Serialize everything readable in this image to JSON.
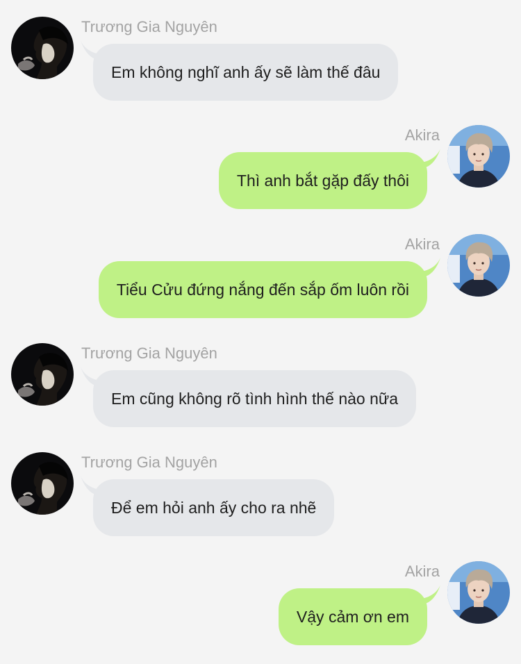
{
  "conversation": {
    "messages": [
      {
        "sender": "Trương Gia Nguyên",
        "text": "Em không nghĩ anh ấy sẽ làm thế đâu",
        "side": "left"
      },
      {
        "sender": "Akira",
        "text": "Thì anh bắt gặp đấy thôi",
        "side": "right"
      },
      {
        "sender": "Akira",
        "text": "Tiểu Cửu đứng nắng đến sắp ốm luôn rồi",
        "side": "right"
      },
      {
        "sender": "Trương Gia Nguyên",
        "text": "Em cũng không rõ tình hình thế nào nữa",
        "side": "left"
      },
      {
        "sender": "Trương Gia Nguyên",
        "text": "Để em hỏi anh ấy cho ra nhẽ",
        "side": "left"
      },
      {
        "sender": "Akira",
        "text": "Vậy cảm ơn em",
        "side": "right"
      }
    ]
  },
  "colors": {
    "background": "#f4f4f4",
    "incoming_bubble": "#e5e7ea",
    "outgoing_bubble": "#bff186",
    "sender_name": "#a3a3a3",
    "message_text": "#1e1e1e"
  }
}
